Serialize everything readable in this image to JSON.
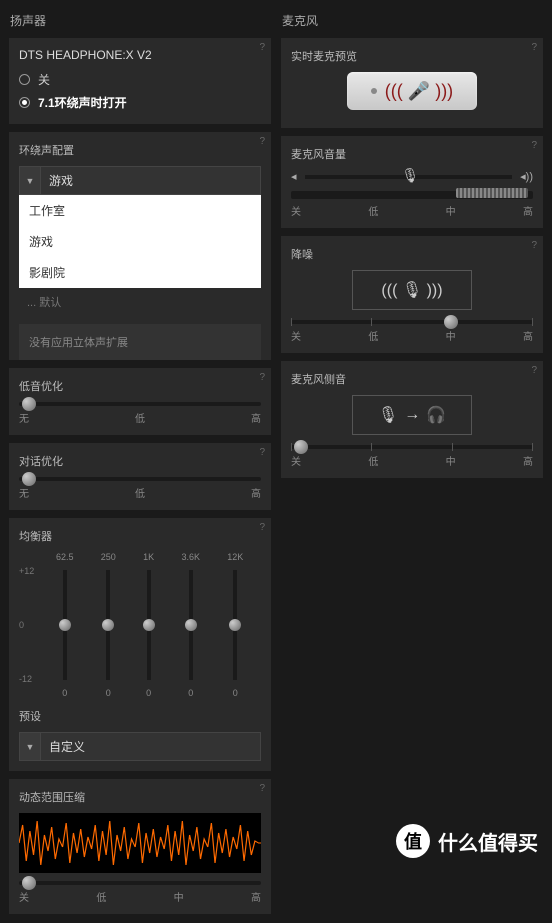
{
  "speaker": {
    "title": "扬声器",
    "dts": "DTS HEADPHONE:X V2",
    "mode_off": "关",
    "mode_on": "7.1环绕声时打开",
    "surround": {
      "title": "环绕声配置",
      "selected": "游戏",
      "options": [
        "工作室",
        "游戏",
        "影剧院"
      ],
      "default_label": "... 默认",
      "stereo_msg": "没有应用立体声扩展"
    },
    "bass": {
      "title": "低音优化",
      "labels": [
        "无",
        "低",
        "高"
      ]
    },
    "dialog": {
      "title": "对话优化",
      "labels": [
        "无",
        "低",
        "高"
      ]
    },
    "eq": {
      "title": "均衡器",
      "freqs": [
        "62.5",
        "250",
        "1K",
        "3.6K",
        "12K"
      ],
      "marks": [
        "+12",
        "0",
        "-12"
      ],
      "values": [
        "0",
        "0",
        "0",
        "0",
        "0"
      ]
    },
    "preset": {
      "title": "预设",
      "selected": "自定义"
    },
    "drc": {
      "title": "动态范围压缩",
      "labels": [
        "关",
        "低",
        "中",
        "高"
      ]
    }
  },
  "mic": {
    "title": "麦克风",
    "preview": "实时麦克预览",
    "volume": {
      "title": "麦克风音量",
      "labels": [
        "关",
        "低",
        "中",
        "高"
      ]
    },
    "nr": {
      "title": "降噪",
      "labels": [
        "关",
        "低",
        "中",
        "高"
      ]
    },
    "sidetone": {
      "title": "麦克风侧音",
      "labels": [
        "关",
        "低",
        "中",
        "高"
      ]
    }
  },
  "watermark": "什么值得买",
  "wm_badge": "值",
  "help": "?"
}
